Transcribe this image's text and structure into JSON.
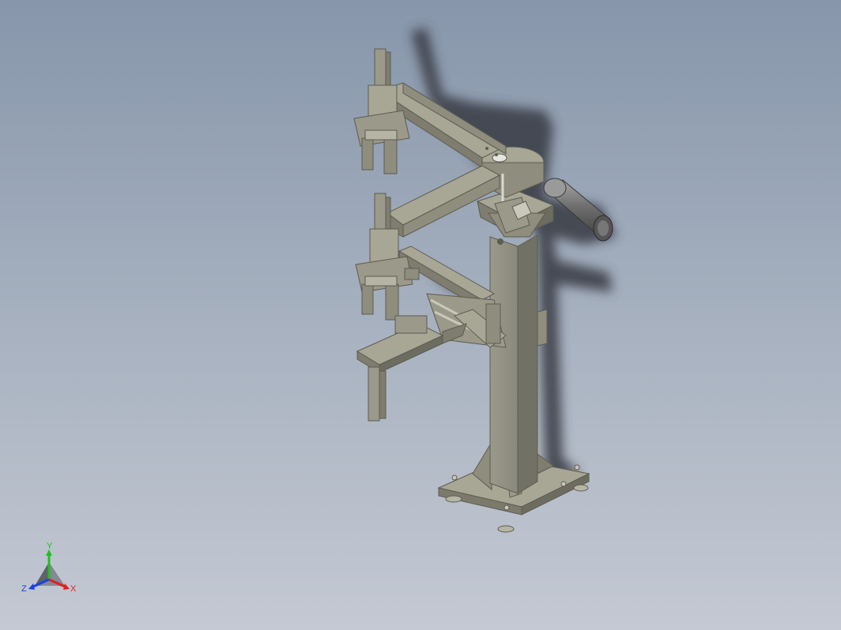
{
  "colors": {
    "background_top": "#8796ab",
    "background_bottom": "#c4c9d3",
    "metal_light": "#a8a796",
    "metal_mid": "#8e8d7e",
    "metal_dark": "#6d6c60",
    "shadow": "#3c4049",
    "axis_x": "#e02020",
    "axis_y": "#20c020",
    "axis_z": "#2040e0"
  },
  "triad": {
    "x_label": "X",
    "y_label": "Y",
    "z_label": "Z"
  }
}
